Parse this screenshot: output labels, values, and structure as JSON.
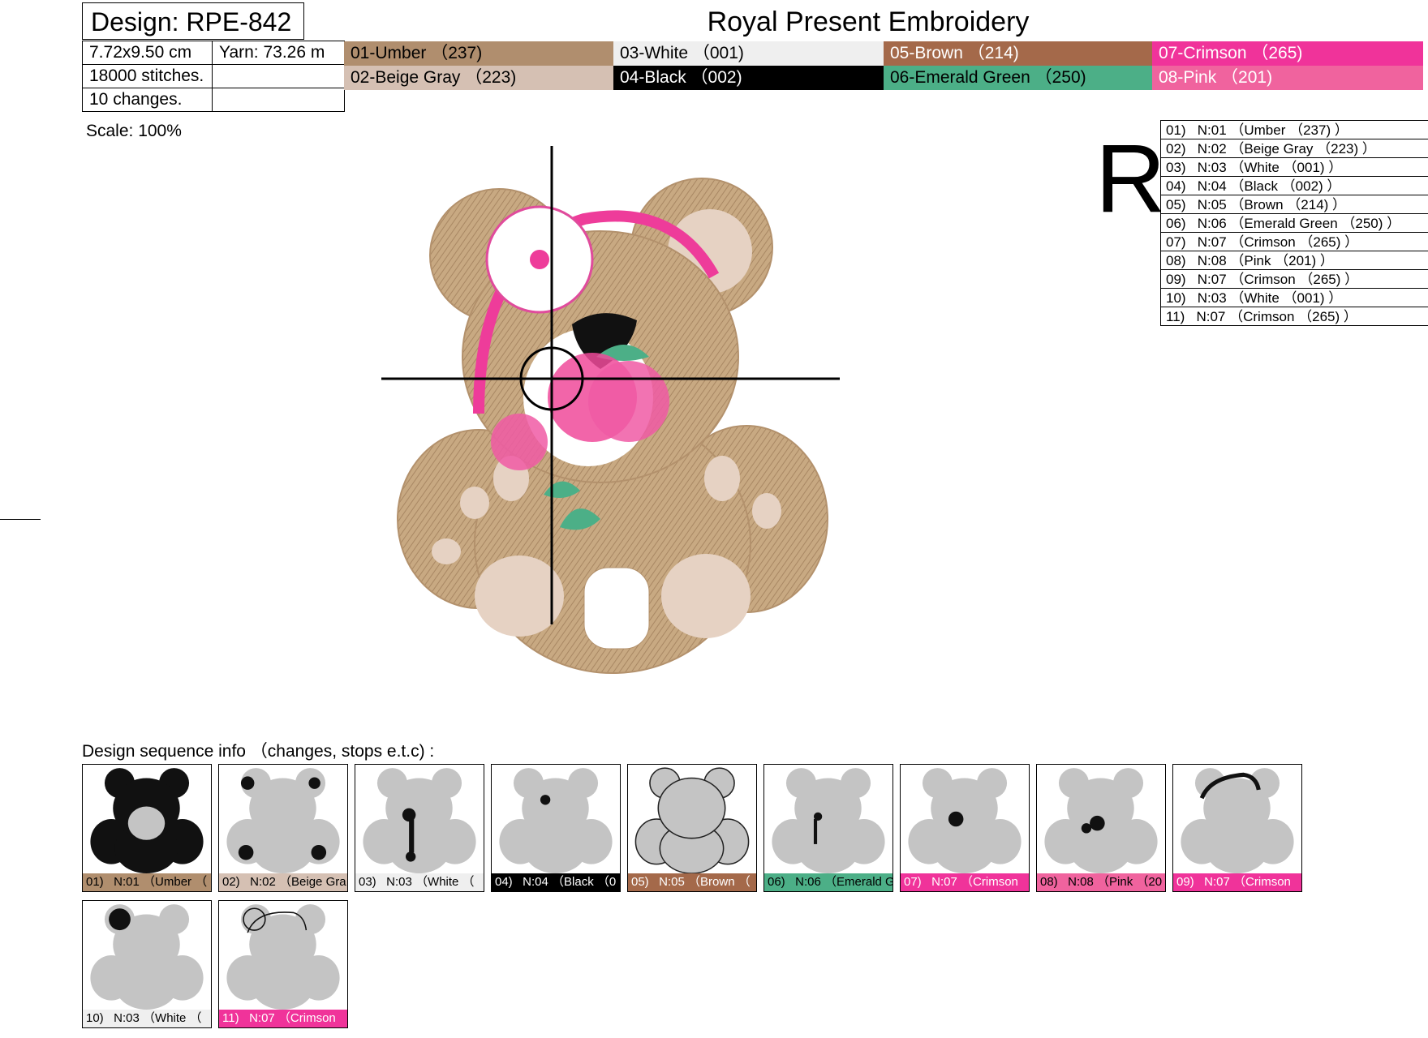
{
  "header": {
    "design": "Design: RPE-842",
    "brand": "Royal Present Embroidery"
  },
  "info": {
    "size": "7.72x9.50 cm",
    "yarn": "Yarn: 73.26 m",
    "stitches": "18000 stitches.",
    "changes": "10 changes.",
    "scale": "Scale: 100%"
  },
  "colors": [
    {
      "label": "01-Umber （237)",
      "bg": "#b08e6e",
      "fg": "#000000"
    },
    {
      "label": "02-Beige Gray （223)",
      "bg": "#d5c0b3",
      "fg": "#000000"
    },
    {
      "label": "03-White （001)",
      "bg": "#efefef",
      "fg": "#000000"
    },
    {
      "label": "04-Black （002)",
      "bg": "#000000",
      "fg": "#ffffff"
    },
    {
      "label": "05-Brown （214)",
      "bg": "#a4694a",
      "fg": "#ffffff"
    },
    {
      "label": "06-Emerald Green （250)",
      "bg": "#4caf87",
      "fg": "#000000"
    },
    {
      "label": "07-Crimson （265)",
      "bg": "#f0339a",
      "fg": "#ffffff"
    },
    {
      "label": "08-Pink （201)",
      "bg": "#f0639e",
      "fg": "#ffffff"
    }
  ],
  "big_letter": "R",
  "sequence": [
    "01)   N:01 （Umber （237) ）",
    "02)   N:02 （Beige Gray （223) ）",
    "03)   N:03 （White （001) ）",
    "04)   N:04 （Black （002) ）",
    "05)   N:05 （Brown （214) ）",
    "06)   N:06 （Emerald Green （250) ）",
    "07)   N:07 （Crimson （265) ）",
    "08)   N:08 （Pink （201) ）",
    "09)   N:07 （Crimson （265) ）",
    "10)   N:03 （White （001) ）",
    "11)   N:07 （Crimson （265) ）"
  ],
  "sequence_label": "Design sequence info （changes, stops e.t.c) :",
  "thumbnails": [
    {
      "caption": "01)   N:01 （Umber （",
      "bg": "#b08e6e",
      "fg": "#000000",
      "highlight": "body"
    },
    {
      "caption": "02)   N:02 （Beige Gra",
      "bg": "#d5c0b3",
      "fg": "#000000",
      "highlight": "pads"
    },
    {
      "caption": "03)   N:03 （White （",
      "bg": "#efefef",
      "fg": "#000000",
      "highlight": "belly"
    },
    {
      "caption": "04)   N:04 （Black （0",
      "bg": "#000000",
      "fg": "#ffffff",
      "highlight": "nose"
    },
    {
      "caption": "05)   N:05 （Brown （",
      "bg": "#a4694a",
      "fg": "#ffffff",
      "highlight": "outline"
    },
    {
      "caption": "06)   N:06 （Emerald G",
      "bg": "#4caf87",
      "fg": "#000000",
      "highlight": "stem"
    },
    {
      "caption": "07)   N:07 （Crimson",
      "bg": "#f0339a",
      "fg": "#ffffff",
      "highlight": "rose1"
    },
    {
      "caption": "08)   N:08 （Pink （20",
      "bg": "#f0639e",
      "fg": "#000000",
      "highlight": "rose2"
    },
    {
      "caption": "09)   N:07 （Crimson",
      "bg": "#f0339a",
      "fg": "#ffffff",
      "highlight": "band"
    },
    {
      "caption": "10)   N:03 （White （",
      "bg": "#efefef",
      "fg": "#000000",
      "highlight": "flower"
    },
    {
      "caption": "11)   N:07 （Crimson",
      "bg": "#f0339a",
      "fg": "#ffffff",
      "highlight": "flowerline"
    }
  ]
}
